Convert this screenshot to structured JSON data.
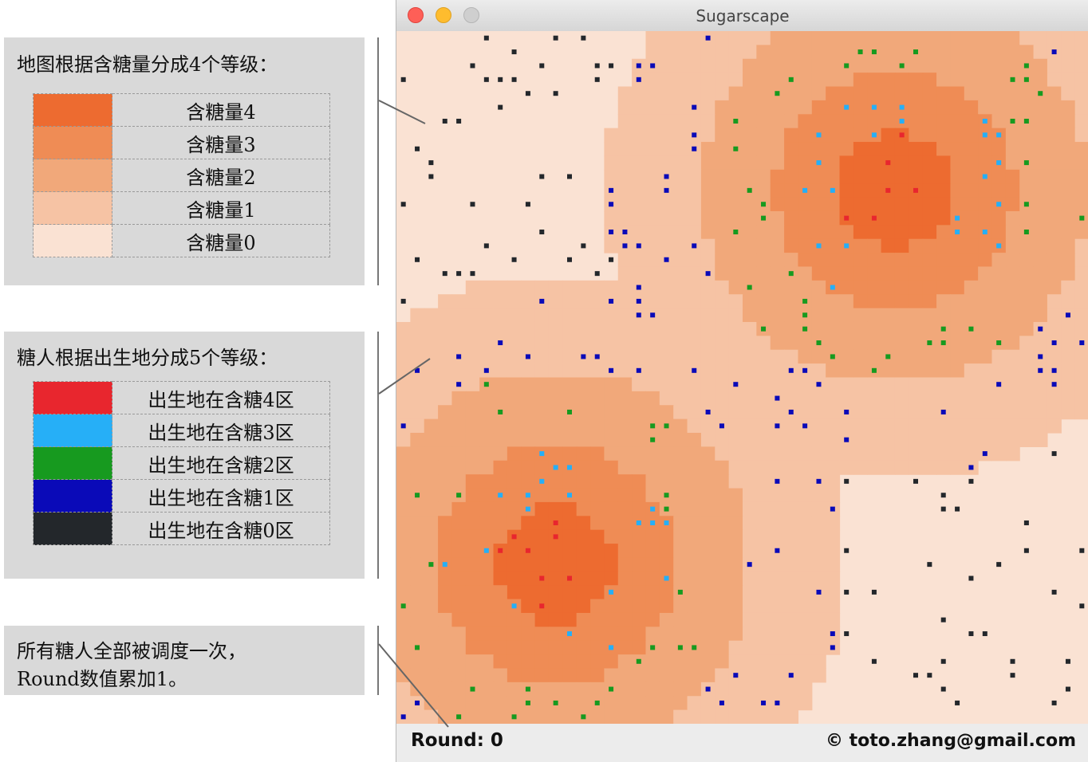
{
  "annotations": {
    "sugar_title": "地图根据含糖量分成4个等级：",
    "sugar_levels": [
      {
        "label": "含糖量4",
        "color": "#ed6b30"
      },
      {
        "label": "含糖量3",
        "color": "#ef8c55"
      },
      {
        "label": "含糖量2",
        "color": "#f1a87a"
      },
      {
        "label": "含糖量1",
        "color": "#f6c3a4"
      },
      {
        "label": "含糖量0",
        "color": "#fae2d3"
      }
    ],
    "agent_title": "糖人根据出生地分成5个等级：",
    "agent_levels": [
      {
        "label": "出生地在含糖4区",
        "color": "#e8262e"
      },
      {
        "label": "出生地在含糖3区",
        "color": "#26aff7"
      },
      {
        "label": "出生地在含糖2区",
        "color": "#179a1f"
      },
      {
        "label": "出生地在含糖1区",
        "color": "#0a0ab8"
      },
      {
        "label": "出生地在含糖0区",
        "color": "#23272b"
      }
    ],
    "round_note_line1": "所有糖人全部被调度一次，",
    "round_note_line2": "Round数值累加1。"
  },
  "window": {
    "title": "Sugarscape",
    "buttons": {
      "close": "#fe5f57",
      "minimize": "#febc2e",
      "zoom": "#c8c8c8"
    }
  },
  "statusbar": {
    "round_label": "Round: 0",
    "copyright": "© toto.zhang@gmail.com"
  },
  "grid": {
    "size": 50,
    "peaks": [
      [
        35.5,
        11.0
      ],
      [
        11.0,
        38.0
      ]
    ]
  }
}
